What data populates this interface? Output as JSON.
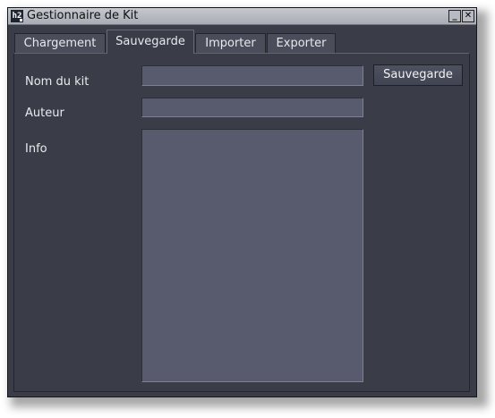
{
  "window": {
    "title": "Gestionnaire de Kit",
    "app_icon": "h2-app-icon",
    "minimize_glyph": "_",
    "close_glyph": "✕"
  },
  "tabs": [
    {
      "label": "Chargement",
      "active": false
    },
    {
      "label": "Sauvegarde",
      "active": true
    },
    {
      "label": "Importer",
      "active": false
    },
    {
      "label": "Exporter",
      "active": false
    }
  ],
  "form": {
    "kit_name_label": "Nom du kit",
    "kit_name_value": "",
    "author_label": "Auteur",
    "author_value": "",
    "info_label": "Info",
    "info_value": "",
    "save_button_label": "Sauvegarde"
  },
  "colors": {
    "window_bg": "#3a3d48",
    "field_bg": "#575b6d",
    "titlebar": "#b7bac2"
  }
}
